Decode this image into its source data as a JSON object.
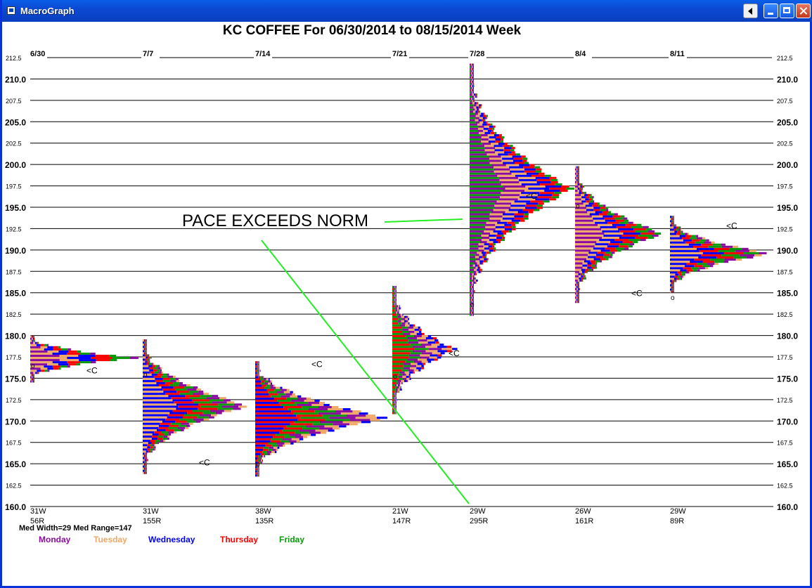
{
  "window": {
    "title": "MacroGraph"
  },
  "colors": {
    "monday": "#8b0ba0",
    "tuesday": "#f0a868",
    "wednesday": "#0000ff",
    "thursday": "#ff0000",
    "friday": "#0a9b0a",
    "annotation_line": "#22ee22"
  },
  "chart_data": {
    "type": "market-profile",
    "title": "KC   COFFEE  For 06/30/2014 to 08/15/2014 Week",
    "ylim": [
      160.0,
      212.5
    ],
    "y_major_ticks": [
      "210.0",
      "205.0",
      "200.0",
      "195.0",
      "190.0",
      "185.0",
      "180.0",
      "175.0",
      "170.0",
      "165.0",
      "160.0"
    ],
    "y_minor_ticks": [
      "212.5",
      "207.5",
      "202.5",
      "197.5",
      "192.5",
      "187.5",
      "182.5",
      "177.5",
      "172.5",
      "167.5",
      "162.5"
    ],
    "weeks": [
      {
        "date": "6/30",
        "width": "31W",
        "range": "56R",
        "low": 174.5,
        "high": 180.0,
        "open": 176.5,
        "close": 176.0
      },
      {
        "date": "7/7",
        "width": "31W",
        "range": "155R",
        "low": 163.8,
        "high": 179.5,
        "open": 175.5,
        "close": 165.2
      },
      {
        "date": "7/14",
        "width": "38W",
        "range": "135R",
        "low": 163.5,
        "high": 177.0,
        "open": 165.0,
        "close": 176.7
      },
      {
        "date": "7/21",
        "width": "21W",
        "range": "147R",
        "low": 170.8,
        "high": 185.7,
        "open": 175.3,
        "close": 178.0
      },
      {
        "date": "7/28",
        "width": "29W",
        "range": "295R",
        "low": 182.3,
        "high": 211.8,
        "open": 183.7,
        "close": 196.4
      },
      {
        "date": "8/4",
        "width": "26W",
        "range": "161R",
        "low": 183.8,
        "high": 199.8,
        "open": 195.2,
        "close": 185.0
      },
      {
        "date": "8/11",
        "width": "29W",
        "range": "89R",
        "low": 185.0,
        "high": 193.9,
        "open": 184.5,
        "close": 192.9
      }
    ],
    "close_marker": "<C",
    "open_marker": "o",
    "annotation": "PACE EXCEEDS NORM",
    "stats": "Med Width=29  Med Range=147",
    "legend": [
      "Monday",
      "Tuesday",
      "Wednesday",
      "Thursday",
      "Friday"
    ]
  }
}
